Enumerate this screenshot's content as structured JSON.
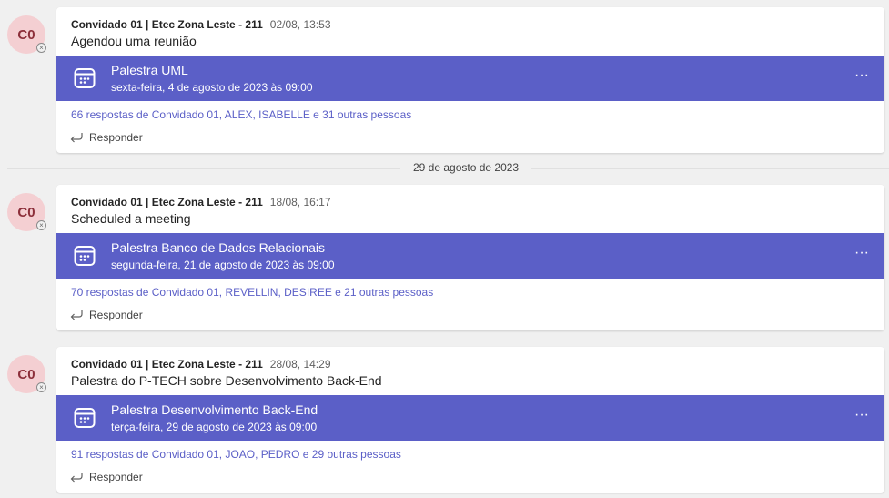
{
  "colors": {
    "accent": "#5b5fc7",
    "avatar_bg": "#f4cfd2",
    "avatar_text": "#8c2f3a",
    "background": "#f0f0f0"
  },
  "date_divider": "29 de agosto de 2023",
  "posts": [
    {
      "avatar": "C0",
      "author": "Convidado 01 | Etec Zona Leste - 211",
      "timestamp": "02/08, 13:53",
      "message": "Agendou uma reunião",
      "meeting": {
        "title": "Palestra UML",
        "date": "sexta-feira, 4 de agosto de 2023 às 09:00",
        "icon": "calendar-icon"
      },
      "more": "···",
      "replies": "66 respostas de Convidado 01, ALEX, ISABELLE e 31 outras pessoas",
      "reply_label": "Responder"
    },
    {
      "avatar": "C0",
      "author": "Convidado 01 | Etec Zona Leste - 211",
      "timestamp": "18/08, 16:17",
      "message": "Scheduled a meeting",
      "meeting": {
        "title": "Palestra Banco de Dados Relacionais",
        "date": "segunda-feira, 21 de agosto de 2023 às 09:00",
        "icon": "calendar-icon"
      },
      "more": "···",
      "replies": "70 respostas de Convidado 01, REVELLIN, DESIREE e 21 outras pessoas",
      "reply_label": "Responder"
    },
    {
      "avatar": "C0",
      "author": "Convidado 01 | Etec Zona Leste - 211",
      "timestamp": "28/08, 14:29",
      "message": "Palestra do P-TECH sobre Desenvolvimento Back-End",
      "meeting": {
        "title": "Palestra Desenvolvimento Back-End",
        "date": "terça-feira, 29 de agosto de 2023 às 09:00",
        "icon": "calendar-icon"
      },
      "more": "···",
      "replies": "91 respostas de Convidado 01, JOAO, PEDRO e 29 outras pessoas",
      "reply_label": "Responder"
    }
  ]
}
